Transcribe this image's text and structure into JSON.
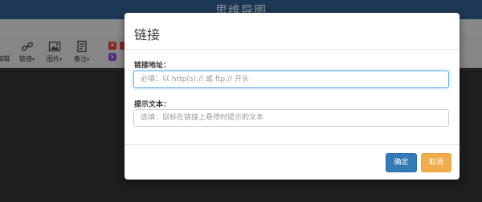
{
  "app": {
    "title": "思维导图"
  },
  "toolbar": {
    "partial_label": "编辑",
    "items": [
      {
        "label": "链接",
        "icon": "link-icon"
      },
      {
        "label": "图片",
        "icon": "image-icon"
      },
      {
        "label": "备注",
        "icon": "note-icon"
      }
    ],
    "caret": "▾",
    "badge_x": "✕",
    "badge_s": "S"
  },
  "dialog": {
    "title": "链接",
    "url_label": "链接地址：",
    "url_placeholder": "必填：以 http(s):// 或 ftp:// 开头",
    "text_label": "提示文本：",
    "text_placeholder": "选填：鼠标在链接上悬停时提示的文本",
    "ok_label": "确定",
    "cancel_label": "取消"
  },
  "colors": {
    "title_bar": "#2f5a8c",
    "primary": "#337ab7",
    "warning": "#f0ad4e",
    "focus": "#66afe9"
  }
}
